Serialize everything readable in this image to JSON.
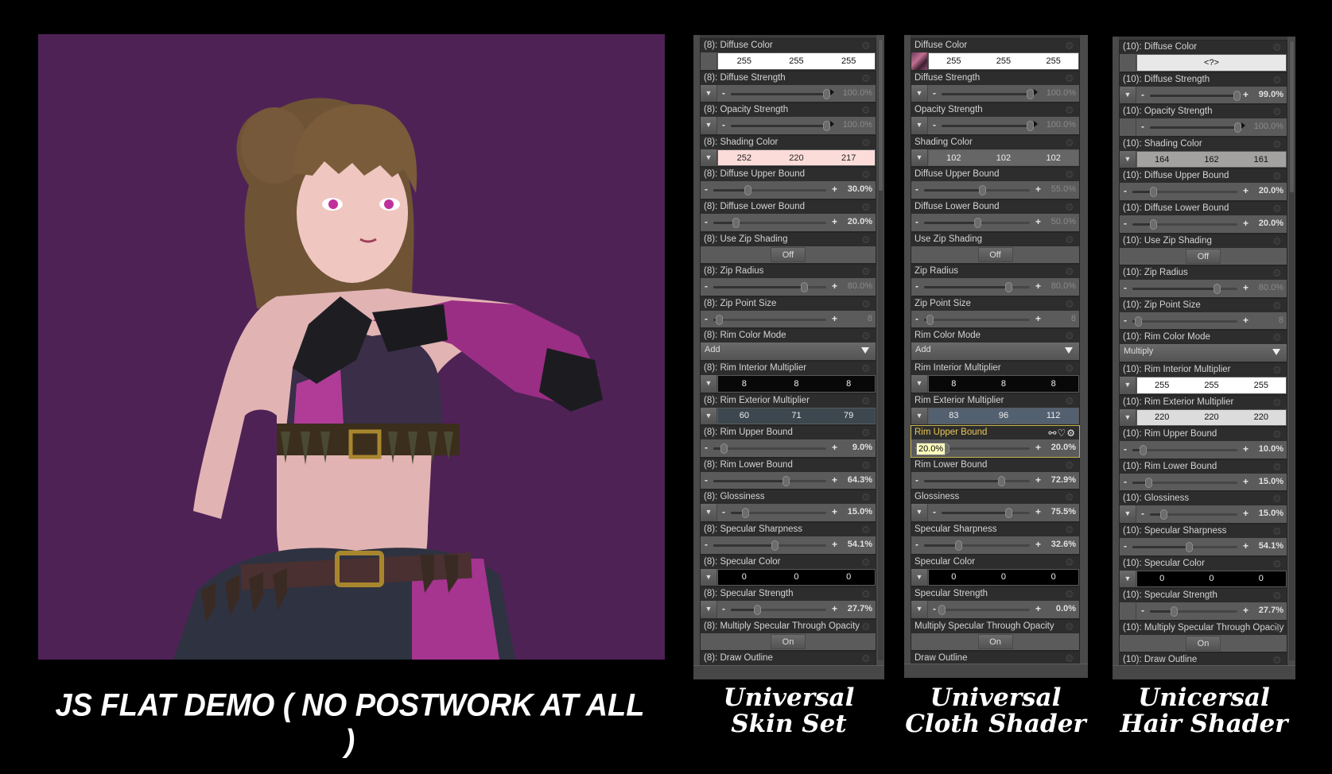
{
  "render": {
    "description": "3D character render, flat toon shading, purple background",
    "background_color": "#4f2256"
  },
  "captions": {
    "main": "JS FLAT DEMO ( NO POSTWORK AT ALL )",
    "skin": [
      "Universal",
      "Skin Set"
    ],
    "cloth": [
      "Universal",
      "Cloth Shader"
    ],
    "hair": [
      "Unicersal",
      "Hair Shader"
    ]
  },
  "panels": [
    {
      "id": "skin",
      "rows": [
        {
          "label": "(8): Diffuse Color",
          "type": "color",
          "left": "swatch",
          "values": [
            "255",
            "255",
            "255"
          ],
          "bg": "#ffffff",
          "fg": "#111111"
        },
        {
          "label": "(8): Diffuse Strength",
          "type": "slider",
          "left": "dd",
          "value": "100.0%",
          "fraction": 1.0,
          "dim": true,
          "ends": "minus-arrow"
        },
        {
          "label": "(8): Opacity Strength",
          "type": "slider",
          "left": "dd",
          "value": "100.0%",
          "fraction": 1.0,
          "dim": true,
          "ends": "minus-arrow"
        },
        {
          "label": "(8): Shading Color",
          "type": "color",
          "left": "dd",
          "values": [
            "252",
            "220",
            "217"
          ],
          "bg": "#fcdcd9",
          "fg": "#222222"
        },
        {
          "label": "(8): Diffuse Upper Bound",
          "type": "slider",
          "left": "none",
          "value": "30.0%",
          "fraction": 0.3,
          "dim": false
        },
        {
          "label": "(8): Diffuse Lower Bound",
          "type": "slider",
          "left": "none",
          "value": "20.0%",
          "fraction": 0.2,
          "dim": false
        },
        {
          "label": "(8): Use Zip Shading",
          "type": "toggle",
          "value": "Off"
        },
        {
          "label": "(8): Zip Radius",
          "type": "slider",
          "left": "none",
          "value": "80.0%",
          "fraction": 0.8,
          "dim": true
        },
        {
          "label": "(8): Zip Point Size",
          "type": "slider",
          "left": "none",
          "value": "8",
          "fraction": 0.05,
          "dim": true
        },
        {
          "label": "(8): Rim Color Mode",
          "type": "select",
          "value": "Add"
        },
        {
          "label": "(8): Rim Interior Multiplier",
          "type": "color",
          "left": "dd",
          "values": [
            "8",
            "8",
            "8"
          ],
          "bg": "#080808",
          "fg": "#eeeeee"
        },
        {
          "label": "(8): Rim Exterior Multiplier",
          "type": "color",
          "left": "dd",
          "values": [
            "60",
            "71",
            "79"
          ],
          "bg": "#3c474f",
          "fg": "#eeeeee"
        },
        {
          "label": "(8): Rim Upper Bound",
          "type": "slider",
          "left": "none",
          "value": "9.0%",
          "fraction": 0.09,
          "dim": false
        },
        {
          "label": "(8): Rim Lower Bound",
          "type": "slider",
          "left": "none",
          "value": "64.3%",
          "fraction": 0.643,
          "dim": false
        },
        {
          "label": "(8): Glossiness",
          "type": "slider",
          "left": "dd",
          "value": "15.0%",
          "fraction": 0.15,
          "dim": false
        },
        {
          "label": "(8): Specular Sharpness",
          "type": "slider",
          "left": "none",
          "value": "54.1%",
          "fraction": 0.541,
          "dim": false
        },
        {
          "label": "(8): Specular Color",
          "type": "color",
          "left": "dd",
          "values": [
            "0",
            "0",
            "0"
          ],
          "bg": "#000000",
          "fg": "#eeeeee"
        },
        {
          "label": "(8): Specular Strength",
          "type": "slider",
          "left": "dd",
          "value": "27.7%",
          "fraction": 0.277,
          "dim": false
        },
        {
          "label": "(8): Multiply Specular Through Opacity",
          "type": "toggle",
          "value": "On"
        },
        {
          "label": "(8): Draw Outline",
          "type": "peek"
        }
      ]
    },
    {
      "id": "cloth",
      "rows": [
        {
          "label": "Diffuse Color",
          "type": "color",
          "left": "texswatch",
          "values": [
            "255",
            "255",
            "255"
          ],
          "bg": "#ffffff",
          "fg": "#111111"
        },
        {
          "label": "Diffuse Strength",
          "type": "slider",
          "left": "dd",
          "value": "100.0%",
          "fraction": 1.0,
          "dim": true,
          "ends": "minus-arrow"
        },
        {
          "label": "Opacity Strength",
          "type": "slider",
          "left": "dd",
          "value": "100.0%",
          "fraction": 1.0,
          "dim": true,
          "ends": "minus-arrow"
        },
        {
          "label": "Shading Color",
          "type": "color",
          "left": "dd",
          "values": [
            "102",
            "102",
            "102"
          ],
          "bg": "#666666",
          "fg": "#f0f0f0"
        },
        {
          "label": "Diffuse Upper Bound",
          "type": "slider",
          "left": "none",
          "value": "55.0%",
          "fraction": 0.55,
          "dim": true
        },
        {
          "label": "Diffuse Lower Bound",
          "type": "slider",
          "left": "none",
          "value": "50.0%",
          "fraction": 0.5,
          "dim": true
        },
        {
          "label": "Use Zip Shading",
          "type": "toggle",
          "value": "Off"
        },
        {
          "label": "Zip Radius",
          "type": "slider",
          "left": "none",
          "value": "80.0%",
          "fraction": 0.8,
          "dim": true
        },
        {
          "label": "Zip Point Size",
          "type": "slider",
          "left": "none",
          "value": "8",
          "fraction": 0.05,
          "dim": true
        },
        {
          "label": "Rim Color Mode",
          "type": "select",
          "value": "Add"
        },
        {
          "label": "Rim Interior Multiplier",
          "type": "color",
          "left": "dd",
          "values": [
            "8",
            "8",
            "8"
          ],
          "bg": "#080808",
          "fg": "#eeeeee"
        },
        {
          "label": "Rim Exterior Multiplier",
          "type": "color",
          "left": "dd",
          "values": [
            "83",
            "96",
            "112"
          ],
          "bg": "#536070",
          "fg": "#eeeeee"
        },
        {
          "label": "Rim Upper Bound",
          "type": "slider",
          "left": "none",
          "value": "20.0%",
          "fraction": 0.2,
          "dim": false,
          "active": true,
          "tooltip": "20.0%"
        },
        {
          "label": "Rim Lower Bound",
          "type": "slider",
          "left": "none",
          "value": "72.9%",
          "fraction": 0.729,
          "dim": false
        },
        {
          "label": "Glossiness",
          "type": "slider",
          "left": "dd",
          "value": "75.5%",
          "fraction": 0.755,
          "dim": false
        },
        {
          "label": "Specular Sharpness",
          "type": "slider",
          "left": "none",
          "value": "32.6%",
          "fraction": 0.326,
          "dim": false
        },
        {
          "label": "Specular Color",
          "type": "color",
          "left": "dd",
          "values": [
            "0",
            "0",
            "0"
          ],
          "bg": "#000000",
          "fg": "#eeeeee"
        },
        {
          "label": "Specular Strength",
          "type": "slider",
          "left": "dd",
          "value": "0.0%",
          "fraction": 0.0,
          "dim": false
        },
        {
          "label": "Multiply Specular Through Opacity",
          "type": "toggle",
          "value": "On"
        },
        {
          "label": "Draw Outline",
          "type": "peek"
        }
      ]
    },
    {
      "id": "hair",
      "rows": [
        {
          "label": "(10): Diffuse Color",
          "type": "color",
          "left": "swatch",
          "values": [
            "<?>"
          ],
          "bg": "#e8e8e8",
          "fg": "#111111"
        },
        {
          "label": "(10): Diffuse Strength",
          "type": "slider",
          "left": "dd",
          "value": "99.0%",
          "fraction": 0.99,
          "dim": false,
          "ends": "minus-plus"
        },
        {
          "label": "(10): Opacity Strength",
          "type": "slider",
          "left": "swatch",
          "value": "100.0%",
          "fraction": 1.0,
          "dim": true,
          "ends": "minus-arrow"
        },
        {
          "label": "(10): Shading Color",
          "type": "color",
          "left": "dd",
          "values": [
            "164",
            "162",
            "161"
          ],
          "bg": "#a4a2a1",
          "fg": "#111111"
        },
        {
          "label": "(10): Diffuse Upper Bound",
          "type": "slider",
          "left": "none",
          "value": "20.0%",
          "fraction": 0.2,
          "dim": false
        },
        {
          "label": "(10): Diffuse Lower Bound",
          "type": "slider",
          "left": "none",
          "value": "20.0%",
          "fraction": 0.2,
          "dim": false
        },
        {
          "label": "(10): Use Zip Shading",
          "type": "toggle",
          "value": "Off"
        },
        {
          "label": "(10): Zip Radius",
          "type": "slider",
          "left": "none",
          "value": "80.0%",
          "fraction": 0.8,
          "dim": true
        },
        {
          "label": "(10): Zip Point Size",
          "type": "slider",
          "left": "none",
          "value": "8",
          "fraction": 0.05,
          "dim": true
        },
        {
          "label": "(10): Rim Color Mode",
          "type": "select",
          "value": "Multiply"
        },
        {
          "label": "(10): Rim Interior Multiplier",
          "type": "color",
          "left": "dd",
          "values": [
            "255",
            "255",
            "255"
          ],
          "bg": "#ffffff",
          "fg": "#111111"
        },
        {
          "label": "(10): Rim Exterior Multiplier",
          "type": "color",
          "left": "dd",
          "values": [
            "220",
            "220",
            "220"
          ],
          "bg": "#dcdcdc",
          "fg": "#111111"
        },
        {
          "label": "(10): Rim Upper Bound",
          "type": "slider",
          "left": "none",
          "value": "10.0%",
          "fraction": 0.1,
          "dim": false
        },
        {
          "label": "(10): Rim Lower Bound",
          "type": "slider",
          "left": "none",
          "value": "15.0%",
          "fraction": 0.15,
          "dim": false
        },
        {
          "label": "(10): Glossiness",
          "type": "slider",
          "left": "dd",
          "value": "15.0%",
          "fraction": 0.15,
          "dim": false
        },
        {
          "label": "(10): Specular Sharpness",
          "type": "slider",
          "left": "none",
          "value": "54.1%",
          "fraction": 0.541,
          "dim": false
        },
        {
          "label": "(10): Specular Color",
          "type": "color",
          "left": "dd",
          "values": [
            "0",
            "0",
            "0"
          ],
          "bg": "#000000",
          "fg": "#eeeeee"
        },
        {
          "label": "(10): Specular Strength",
          "type": "slider",
          "left": "swatch",
          "value": "27.7%",
          "fraction": 0.277,
          "dim": false
        },
        {
          "label": "(10): Multiply Specular Through Opacity",
          "type": "toggle",
          "value": "On"
        },
        {
          "label": "(10): Draw Outline",
          "type": "peek"
        }
      ]
    }
  ],
  "icons": {
    "gear": "gear-icon",
    "dropdown": "triangle-down-icon",
    "link": "link-icon",
    "favorite": "heart-icon"
  }
}
